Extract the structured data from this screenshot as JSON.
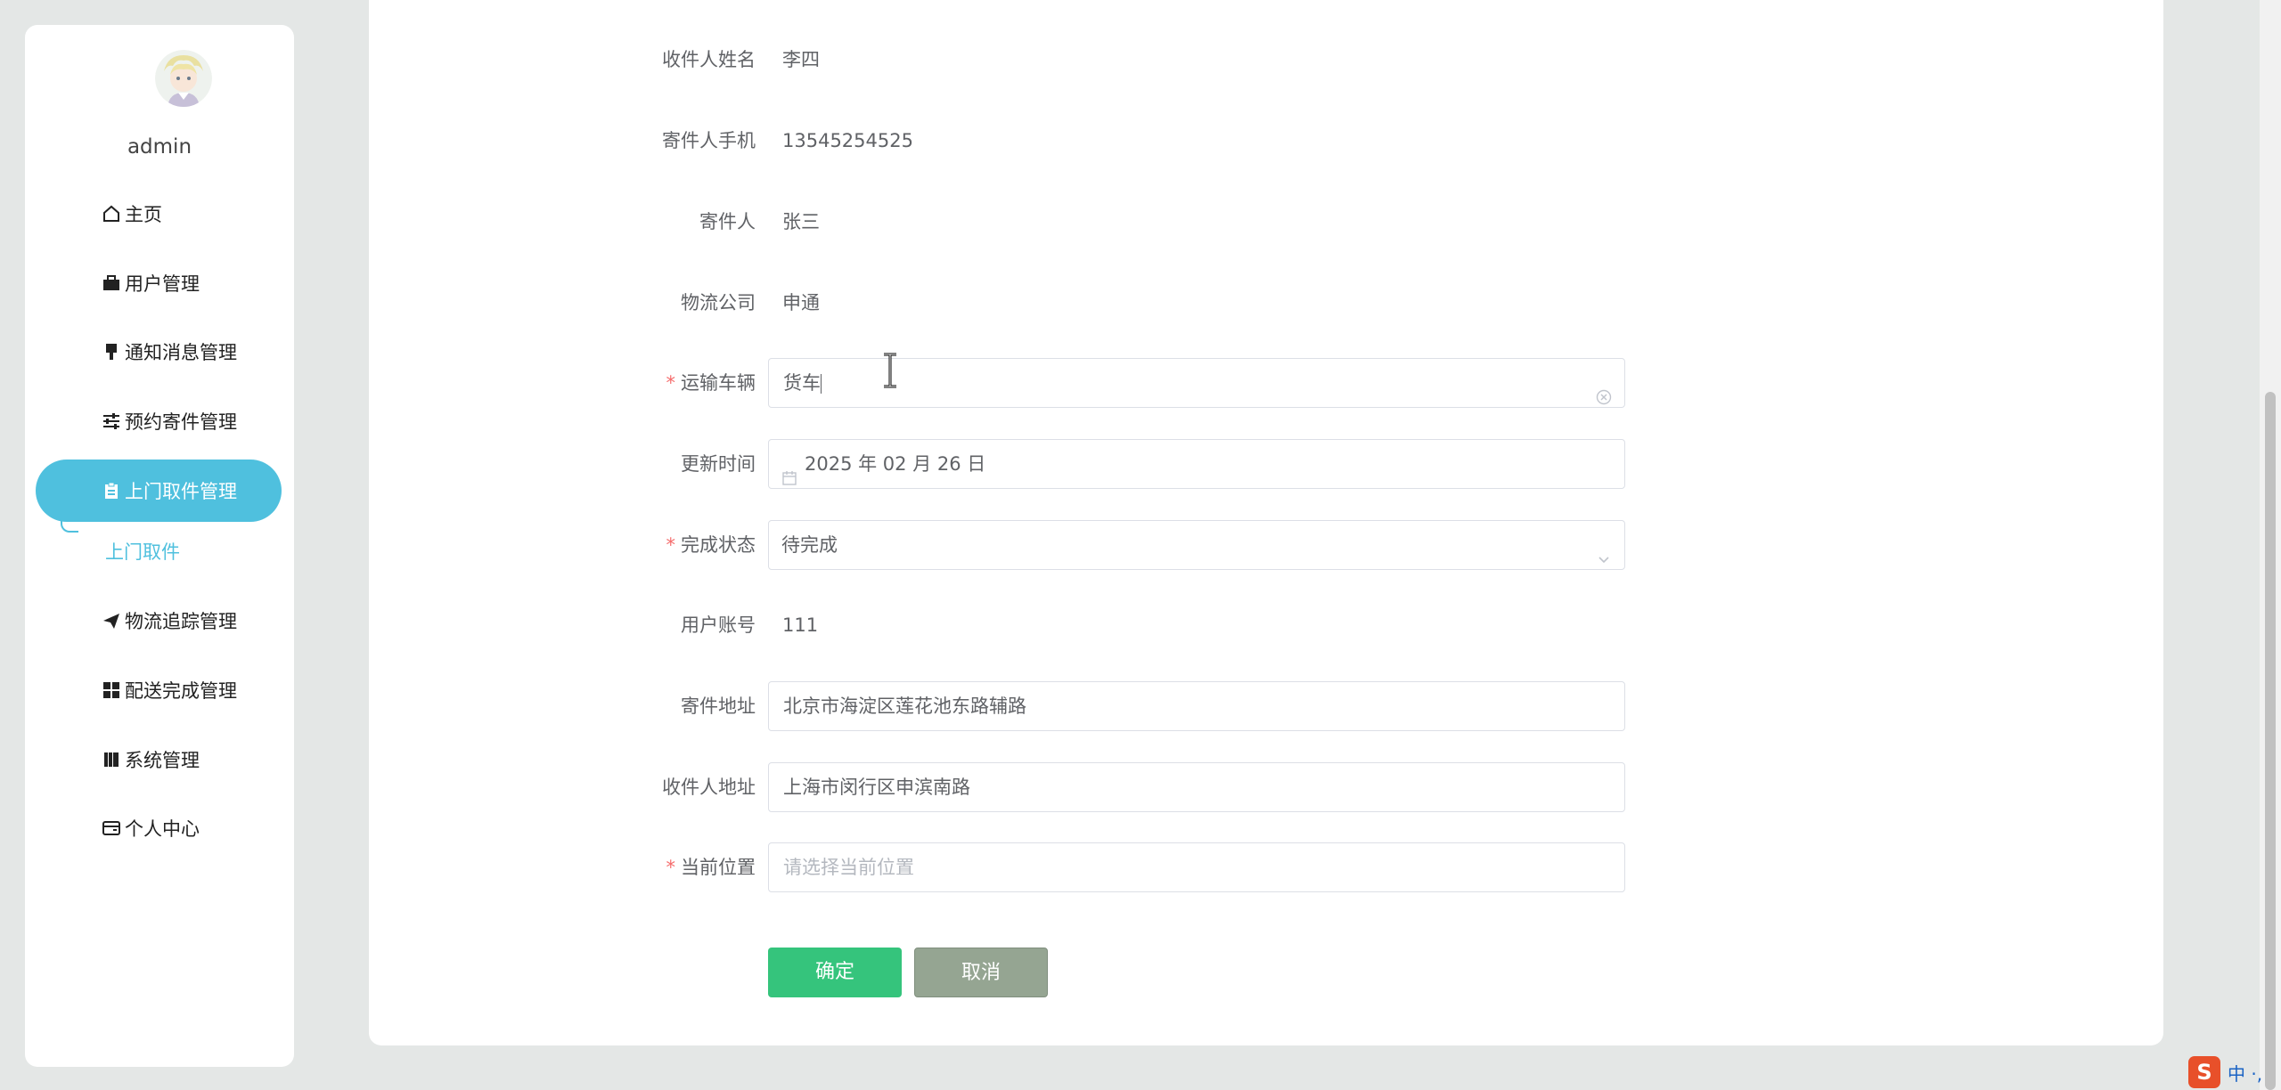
{
  "sidebar": {
    "username": "admin",
    "items": [
      {
        "label": "主页",
        "icon": "home-icon"
      },
      {
        "label": "用户管理",
        "icon": "briefcase-icon"
      },
      {
        "label": "通知消息管理",
        "icon": "brush-icon"
      },
      {
        "label": "预约寄件管理",
        "icon": "sliders-icon"
      },
      {
        "label": "上门取件管理",
        "icon": "clipboard-icon",
        "active": true
      },
      {
        "label": "物流追踪管理",
        "icon": "paper-plane-icon"
      },
      {
        "label": "配送完成管理",
        "icon": "grid-icon"
      },
      {
        "label": "系统管理",
        "icon": "book-icon"
      },
      {
        "label": "个人中心",
        "icon": "wallet-icon"
      }
    ],
    "subitem": "上门取件"
  },
  "form": {
    "receiver_name": {
      "label": "收件人姓名",
      "value": "李四"
    },
    "sender_phone": {
      "label": "寄件人手机",
      "value": "13545254525"
    },
    "sender": {
      "label": "寄件人",
      "value": "张三"
    },
    "logistics_company": {
      "label": "物流公司",
      "value": "申通"
    },
    "vehicle": {
      "label": "运输车辆",
      "value": "货车",
      "required": true
    },
    "update_time": {
      "label": "更新时间",
      "value": "2025 年 02 月 26 日"
    },
    "status": {
      "label": "完成状态",
      "value": "待完成",
      "required": true
    },
    "user_account": {
      "label": "用户账号",
      "value": "111"
    },
    "sender_address": {
      "label": "寄件地址",
      "value": "北京市海淀区莲花池东路辅路"
    },
    "receiver_address": {
      "label": "收件人地址",
      "value": "上海市闵行区申滨南路"
    },
    "current_location": {
      "label": "当前位置",
      "placeholder": "请选择当前位置",
      "required": true
    }
  },
  "buttons": {
    "confirm": "确定",
    "cancel": "取消"
  },
  "ime": {
    "logo": "S",
    "text": "中 ·,"
  },
  "colors": {
    "accent": "#4fc0de",
    "confirm": "#35c47c",
    "cancel": "#95a592",
    "required": "#f56c6c"
  }
}
